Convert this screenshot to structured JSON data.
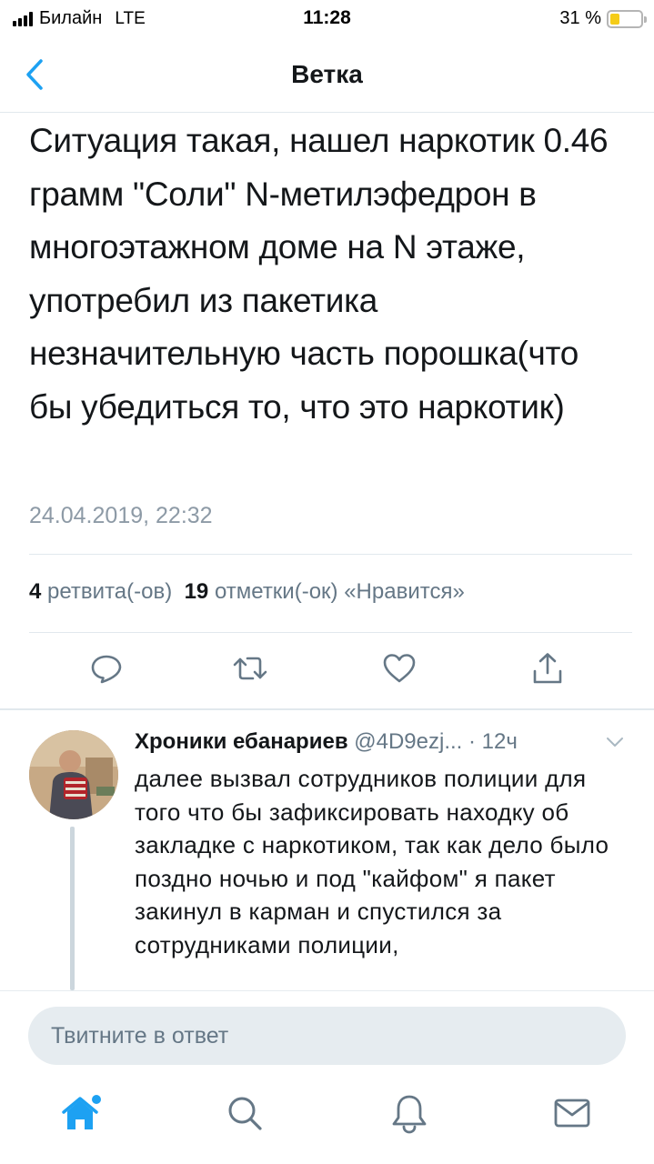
{
  "status_bar": {
    "carrier": "Билайн",
    "network": "LTE",
    "time": "11:28",
    "battery_percent": "31 %",
    "battery_level": 0.31,
    "battery_color": "#f5cc18"
  },
  "nav": {
    "title": "Ветка",
    "back_icon": "chevron-left-icon"
  },
  "tweet": {
    "text": "Ситуация такая, нашел наркотик 0.46 грамм \"Соли\" N-метилэфедрон в многоэтажном доме на N этаже, употребил из пакетика незначительную часть порошка(что бы убедиться то, что это наркотик)",
    "date": "24.04.2019, 22:32",
    "retweet_count": "4",
    "retweet_label": "ретвита(-ов)",
    "like_count": "19",
    "like_label": "отметки(-ок) «Нравится»",
    "actions": [
      "reply-icon",
      "retweet-icon",
      "heart-icon",
      "share-icon"
    ]
  },
  "reply": {
    "name": "Хроники ебанариев",
    "handle": "@4D9ezj...",
    "time": "· 12ч",
    "text": "далее вызвал сотрудников полиции для того что бы зафиксировать находку об закладке с наркотиком, так как дело было поздно ночью и под \"кайфом\" я пакет закинул в карман и спустился за сотрудниками полиции,"
  },
  "composer": {
    "placeholder": "Твитните в ответ"
  },
  "tab_bar": {
    "tabs": [
      "home-icon",
      "search-icon",
      "notifications-icon",
      "messages-icon"
    ],
    "active_color": "#1da1f2",
    "inactive_color": "#657786"
  },
  "colors": {
    "accent": "#1da1f2",
    "secondary_text": "#657786",
    "divider": "#e1e8ed"
  }
}
